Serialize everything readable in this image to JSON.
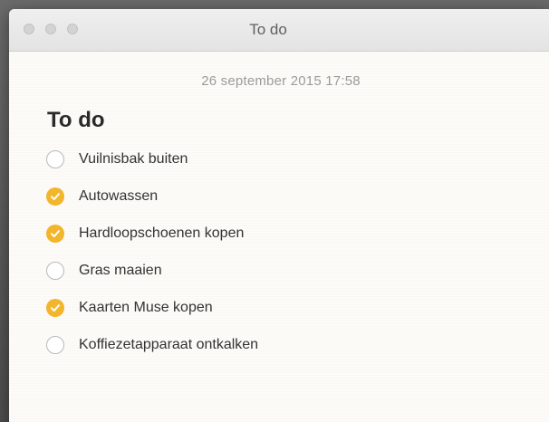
{
  "window": {
    "title": "To do"
  },
  "note": {
    "date": "26 september 2015 17:58",
    "title": "To do",
    "items": [
      {
        "label": "Vuilnisbak buiten",
        "checked": false
      },
      {
        "label": "Autowassen",
        "checked": true
      },
      {
        "label": "Hardloopschoenen kopen",
        "checked": true
      },
      {
        "label": "Gras maaien",
        "checked": false
      },
      {
        "label": "Kaarten Muse kopen",
        "checked": true
      },
      {
        "label": "Koffiezetapparaat ontkalken",
        "checked": false
      }
    ]
  },
  "colors": {
    "check_accent": "#f3b52b"
  },
  "icons": {
    "checked": "checkmark-icon",
    "unchecked": "empty-circle-icon"
  }
}
